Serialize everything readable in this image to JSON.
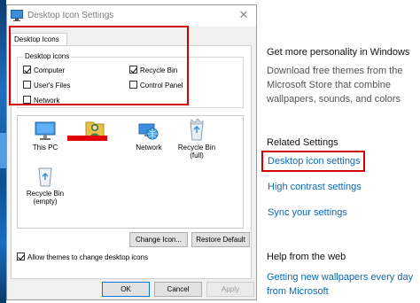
{
  "dialog": {
    "title": "Desktop Icon Settings",
    "close_glyph": "✕",
    "tab_label": "Desktop Icons",
    "group_label": "Desktop icons",
    "checkboxes": [
      {
        "label": "Computer",
        "checked": true
      },
      {
        "label": "Recycle Bin",
        "checked": true
      },
      {
        "label": "User's Files",
        "checked": false
      },
      {
        "label": "Control Panel",
        "checked": false
      },
      {
        "label": "Network",
        "checked": false
      }
    ],
    "icons": [
      {
        "label": "This PC",
        "icon": "monitor-icon"
      },
      {
        "label": "",
        "icon": "user-folder-icon"
      },
      {
        "label": "Network",
        "icon": "network-globe-icon"
      },
      {
        "label": "Recycle Bin\n(full)",
        "line1": "Recycle Bin",
        "line2": "(full)",
        "icon": "recycle-bin-full-icon"
      },
      {
        "label": "Recycle Bin\n(empty)",
        "line1": "Recycle Bin",
        "line2": "(empty)",
        "icon": "recycle-bin-empty-icon"
      }
    ],
    "change_icon_label": "Change Icon...",
    "restore_default_label": "Restore Default",
    "allow_themes_label": "Allow themes to change desktop icons",
    "allow_themes_checked": true,
    "ok_label": "OK",
    "cancel_label": "Cancel",
    "apply_label": "Apply"
  },
  "settings_pane": {
    "personality_heading": "Get more personality in Windows",
    "personality_desc_1": "Download free themes from the",
    "personality_desc_2": "Microsoft Store that combine",
    "personality_desc_3": "wallpapers, sounds, and colors",
    "related_heading": "Related Settings",
    "desktop_icon_settings": "Desktop icon settings",
    "high_contrast_settings": "High contrast settings",
    "sync_settings": "Sync your settings",
    "help_heading": "Help from the web",
    "help_link_1": "Getting new wallpapers every day",
    "help_link_2": "from Microsoft"
  },
  "colors": {
    "highlight": "#d40000",
    "link": "#0a69b8",
    "redaction": "#e30000"
  }
}
